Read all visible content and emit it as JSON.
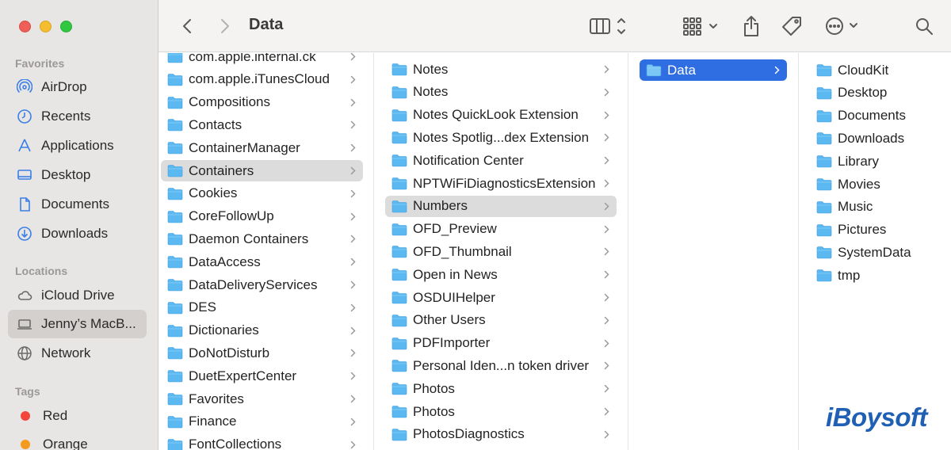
{
  "window": {
    "title": "Data"
  },
  "sidebar": {
    "favorites_label": "Favorites",
    "favorites": [
      {
        "label": "AirDrop",
        "icon": "airdrop-icon"
      },
      {
        "label": "Recents",
        "icon": "clock-icon"
      },
      {
        "label": "Applications",
        "icon": "applications-icon"
      },
      {
        "label": "Desktop",
        "icon": "desktop-icon"
      },
      {
        "label": "Documents",
        "icon": "document-icon"
      },
      {
        "label": "Downloads",
        "icon": "download-icon"
      }
    ],
    "locations_label": "Locations",
    "locations": [
      {
        "label": "iCloud Drive",
        "icon": "cloud-icon"
      },
      {
        "label": "Jenny’s MacB...",
        "icon": "laptop-icon",
        "selected": true
      },
      {
        "label": "Network",
        "icon": "globe-icon"
      }
    ],
    "tags_label": "Tags",
    "tags": [
      {
        "label": "Red",
        "color": "#f2463d"
      },
      {
        "label": "Orange",
        "color": "#f59a20"
      }
    ]
  },
  "toolbar": {
    "back": "back-chevron-icon",
    "forward": "forward-chevron-icon",
    "view": "column-view-icon",
    "group": "grid-group-icon",
    "share": "share-icon",
    "tag": "tag-icon",
    "more": "ellipsis-icon",
    "search": "search-icon"
  },
  "columns": {
    "col1": [
      {
        "label": "com.apple.internal.ck"
      },
      {
        "label": "com.apple.iTunesCloud"
      },
      {
        "label": "Compositions"
      },
      {
        "label": "Contacts"
      },
      {
        "label": "ContainerManager"
      },
      {
        "label": "Containers",
        "selected": true
      },
      {
        "label": "Cookies"
      },
      {
        "label": "CoreFollowUp"
      },
      {
        "label": "Daemon Containers"
      },
      {
        "label": "DataAccess"
      },
      {
        "label": "DataDeliveryServices"
      },
      {
        "label": "DES"
      },
      {
        "label": "Dictionaries"
      },
      {
        "label": "DoNotDisturb"
      },
      {
        "label": "DuetExpertCenter"
      },
      {
        "label": "Favorites"
      },
      {
        "label": "Finance"
      },
      {
        "label": "FontCollections"
      }
    ],
    "col2": [
      {
        "label": "Notes"
      },
      {
        "label": "Notes"
      },
      {
        "label": "Notes QuickLook Extension"
      },
      {
        "label": "Notes Spotlig...dex Extension"
      },
      {
        "label": "Notification Center"
      },
      {
        "label": "NPTWiFiDiagnosticsExtension"
      },
      {
        "label": "Numbers",
        "selected": true
      },
      {
        "label": "OFD_Preview"
      },
      {
        "label": "OFD_Thumbnail"
      },
      {
        "label": "Open in News"
      },
      {
        "label": "OSDUIHelper"
      },
      {
        "label": "Other Users"
      },
      {
        "label": "PDFImporter"
      },
      {
        "label": "Personal Iden...n token driver"
      },
      {
        "label": "Photos"
      },
      {
        "label": "Photos"
      },
      {
        "label": "PhotosDiagnostics"
      }
    ],
    "col3": [
      {
        "label": "Data",
        "selected": true
      }
    ],
    "col4": [
      {
        "label": "CloudKit"
      },
      {
        "label": "Desktop"
      },
      {
        "label": "Documents"
      },
      {
        "label": "Downloads"
      },
      {
        "label": "Library"
      },
      {
        "label": "Movies"
      },
      {
        "label": "Music"
      },
      {
        "label": "Pictures"
      },
      {
        "label": "SystemData"
      },
      {
        "label": "tmp"
      }
    ]
  },
  "watermark": "iBoysoft",
  "colors": {
    "accent": "#2f6ee2",
    "folder": "#5bb8f0"
  }
}
